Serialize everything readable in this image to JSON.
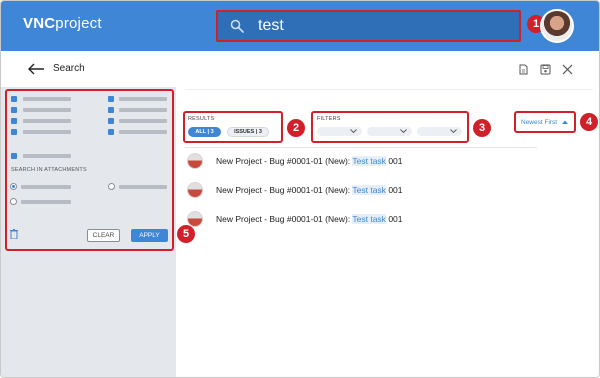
{
  "app": {
    "logo_bold": "VNC",
    "logo_light": "project"
  },
  "search": {
    "query": "test"
  },
  "page": {
    "title": "Search"
  },
  "badges": [
    "1",
    "2",
    "3",
    "4",
    "5"
  ],
  "sidebar": {
    "attachments_label": "SEARCH IN ATTACHMENTS",
    "clear_label": "CLEAR",
    "apply_label": "APPLY"
  },
  "results": {
    "label": "RESULTS",
    "all_label": "ALL",
    "all_count": "3",
    "issues_label": "ISSUES",
    "issues_count": "3"
  },
  "filters": {
    "label": "FILTERS"
  },
  "sort": {
    "label": "Newest First"
  },
  "rows": [
    {
      "prefix": "New Project - Bug #0001-01 (New):",
      "highlight": "Test task",
      "suffix": "001"
    },
    {
      "prefix": "New Project - Bug #0001-01 (New):",
      "highlight": "Test task",
      "suffix": "001"
    },
    {
      "prefix": "New Project - Bug #0001-01 (New):",
      "highlight": "Test task",
      "suffix": "001"
    }
  ],
  "colors": {
    "accent": "#3f87d6",
    "callout": "#d0202a",
    "sidebar": "#e4e7ec"
  },
  "icons": [
    "search-icon",
    "back-arrow-icon",
    "document-icon",
    "save-icon",
    "close-icon",
    "trash-icon",
    "chevron-down-icon",
    "sort-up-icon"
  ]
}
